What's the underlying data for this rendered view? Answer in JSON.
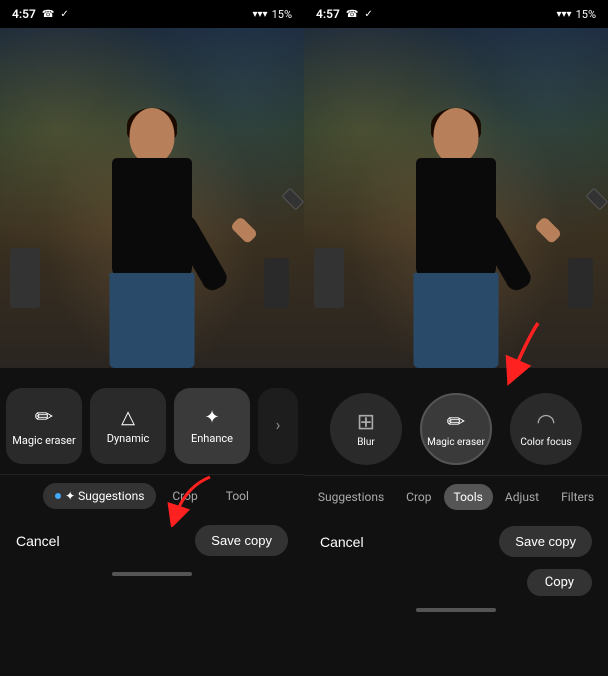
{
  "left_panel": {
    "status": {
      "time": "4:57",
      "battery": "15%"
    },
    "tabs": [
      {
        "label": "✦ Suggestions",
        "active": true
      },
      {
        "label": "Crop",
        "active": false
      },
      {
        "label": "Tool",
        "active": false
      }
    ],
    "tools": [
      {
        "id": "magic-eraser",
        "label": "Magic eraser",
        "icon": "✏️"
      },
      {
        "id": "dynamic",
        "label": "Dynamic",
        "icon": "▲"
      },
      {
        "id": "enhance",
        "label": "Enhance",
        "icon": "✧"
      },
      {
        "id": "more",
        "label": "",
        "icon": "C"
      }
    ],
    "actions": {
      "cancel": "Cancel",
      "save": "Save copy"
    }
  },
  "right_panel": {
    "status": {
      "time": "4:57",
      "battery": "15%"
    },
    "tabs": [
      {
        "label": "Suggestions",
        "active": false
      },
      {
        "label": "Crop",
        "active": false
      },
      {
        "label": "Tools",
        "active": true
      },
      {
        "label": "Adjust",
        "active": false
      },
      {
        "label": "Filters",
        "active": false
      }
    ],
    "tools": [
      {
        "id": "blur",
        "label": "Blur",
        "icon": "⊞"
      },
      {
        "id": "magic-eraser",
        "label": "Magic eraser",
        "icon": "✏️",
        "selected": true
      },
      {
        "id": "color-focus",
        "label": "Color focus",
        "icon": "◠"
      }
    ],
    "actions": {
      "cancel": "Cancel",
      "save": "Save copy"
    },
    "copy_label": "Copy"
  },
  "icons": {
    "wifi": "▲",
    "battery": "🔋"
  }
}
